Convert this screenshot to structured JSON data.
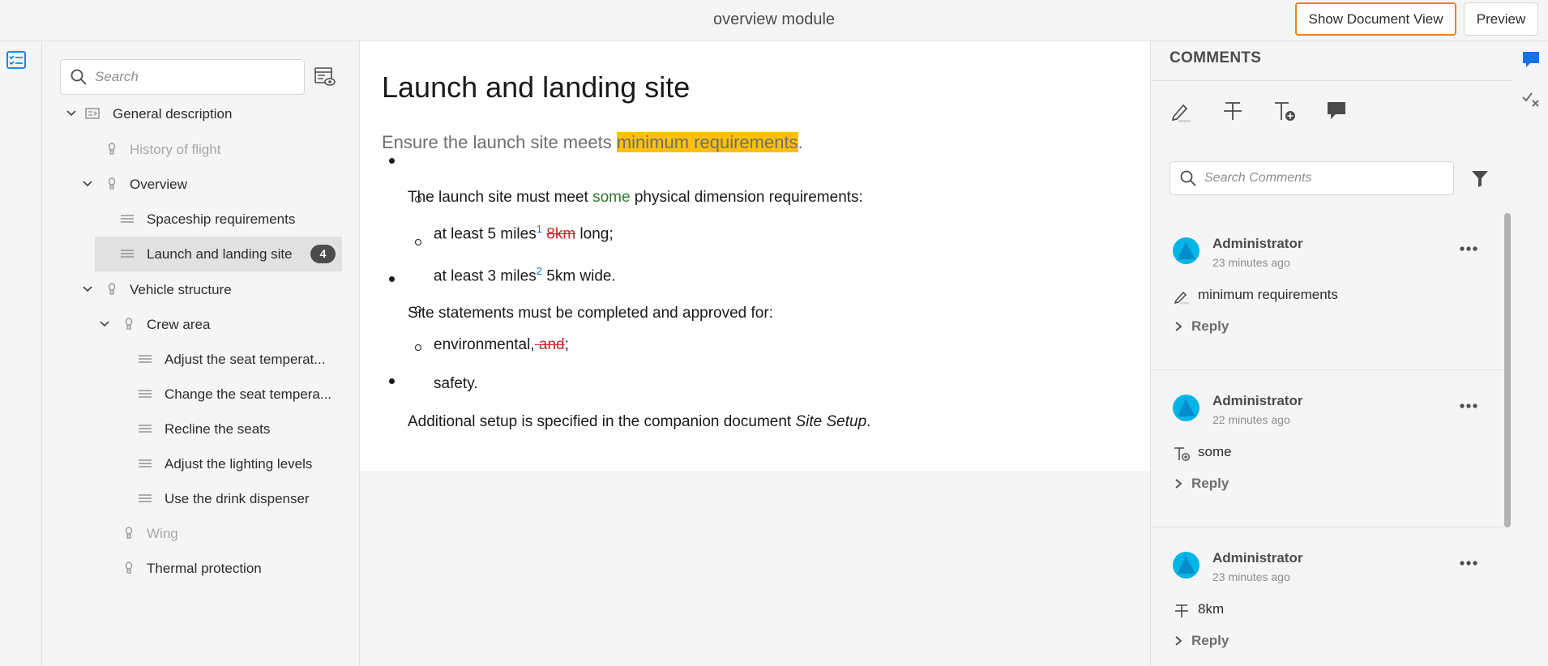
{
  "header": {
    "title": "overview module",
    "show_document_view_label": "Show Document View",
    "preview_label": "Preview"
  },
  "tree": {
    "search_placeholder": "Search",
    "items": [
      {
        "label": "General description",
        "icon": "topic-map-icon",
        "expanded": true,
        "muted": false
      },
      {
        "label": "History of flight",
        "icon": "bulb-icon",
        "muted": true
      },
      {
        "label": "Overview",
        "icon": "bulb-icon",
        "expanded": true,
        "muted": false
      },
      {
        "label": "Spaceship requirements",
        "icon": "lines-icon",
        "muted": false
      },
      {
        "label": "Launch and landing site",
        "icon": "lines-icon",
        "muted": false,
        "selected": true,
        "badge": "4"
      },
      {
        "label": "Vehicle structure",
        "icon": "bulb-icon",
        "expanded": true,
        "muted": false
      },
      {
        "label": "Crew area",
        "icon": "bulb-icon",
        "expanded": true,
        "muted": false
      },
      {
        "label": "Adjust the seat temperat...",
        "icon": "lines-icon",
        "muted": false
      },
      {
        "label": "Change the seat tempera...",
        "icon": "lines-icon",
        "muted": false
      },
      {
        "label": "Recline the seats",
        "icon": "lines-icon",
        "muted": false
      },
      {
        "label": "Adjust the lighting levels",
        "icon": "lines-icon",
        "muted": false
      },
      {
        "label": "Use the drink dispenser",
        "icon": "lines-icon",
        "muted": false
      },
      {
        "label": "Wing",
        "icon": "bulb-icon",
        "muted": true
      },
      {
        "label": "Thermal protection",
        "icon": "bulb-icon",
        "muted": false
      }
    ]
  },
  "editor": {
    "title": "Launch and landing site",
    "shortdesc_before": "Ensure the launch site meets ",
    "shortdesc_highlight": "minimum requirements",
    "shortdesc_after": ".",
    "b1_before": "The launch site must meet ",
    "b1_inserted": "some",
    "b1_after": " physical dimension requirements:",
    "s1_before": "at least 5 miles",
    "s1_sup": "1",
    "s1_deleted": "8km",
    "s1_after": " long;",
    "s2_before": "at least 3 miles",
    "s2_sup": "2",
    "s2_after": " 5km wide.",
    "b2": "Site statements must be completed and approved for:",
    "s3_before": "environmental,",
    "s3_deleted": " and",
    "s3_after": ";",
    "s4": "safety.",
    "b3_before": "Additional setup is specified in the companion document ",
    "b3_italic": "Site Setup",
    "b3_after": "."
  },
  "comments": {
    "header": "COMMENTS",
    "search_placeholder": "Search Comments",
    "tools": [
      "highlight-pen-icon",
      "strikethrough-icon",
      "insert-text-icon",
      "comment-bubble-icon"
    ],
    "items": [
      {
        "author": "Administrator",
        "time": "23 minutes ago",
        "type_icon": "highlight-pen-icon",
        "text": "minimum requirements",
        "reply": "Reply"
      },
      {
        "author": "Administrator",
        "time": "22 minutes ago",
        "type_icon": "insert-text-icon",
        "text": "some",
        "reply": "Reply"
      },
      {
        "author": "Administrator",
        "time": "23 minutes ago",
        "type_icon": "strikethrough-icon",
        "text": "8km",
        "reply": "Reply"
      }
    ]
  },
  "colors": {
    "accent": "#1473e6",
    "focus_orange": "#e68619",
    "highlight": "#ffc107",
    "insert_green": "#2d7d2d",
    "delete_red": "#c9252d",
    "avatar": "#00b4e6"
  }
}
